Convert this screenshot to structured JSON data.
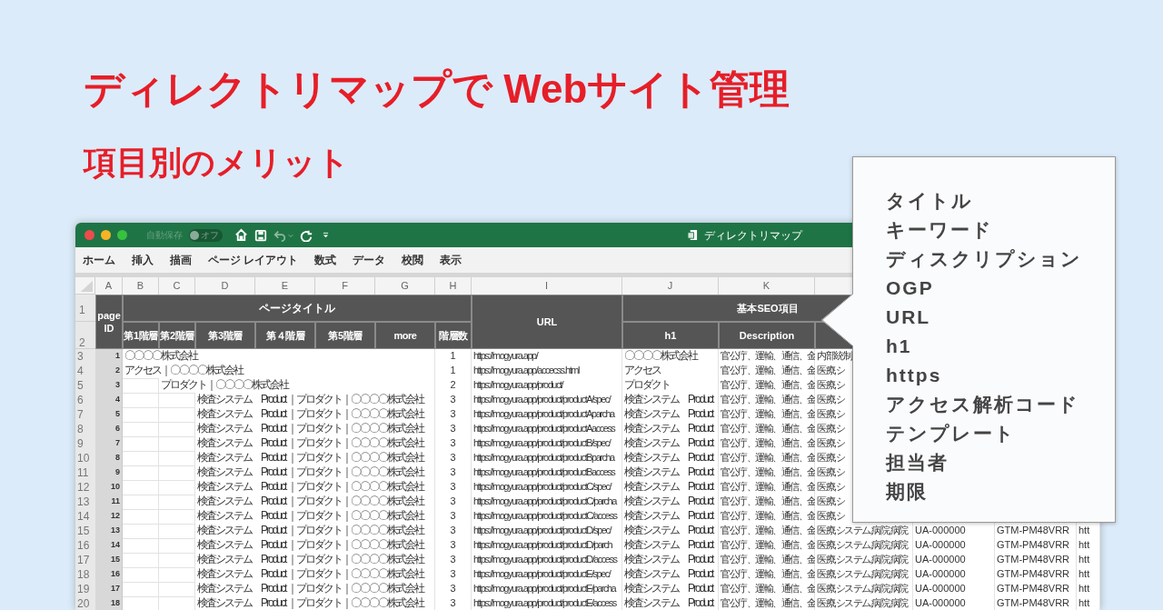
{
  "headline": "ディレクトリマップで Webサイト管理",
  "subheadline": "項目別のメリット",
  "window": {
    "title": "ディレクトリマップ",
    "autosave": {
      "label": "自動保存",
      "toggle_text": "オフ",
      "on": false
    }
  },
  "ribbon_tabs": [
    "ホーム",
    "挿入",
    "描画",
    "ページ レイアウト",
    "数式",
    "データ",
    "校閲",
    "表示"
  ],
  "sheet": {
    "column_letters": [
      "A",
      "B",
      "C",
      "D",
      "E",
      "F",
      "G",
      "H",
      "I",
      "J",
      "K"
    ],
    "header": {
      "row_numbers": [
        "1",
        "2"
      ],
      "page_id": "page ID",
      "page_title": "ページタイトル",
      "levels": [
        "第1階層",
        "第2階層",
        "第3階層",
        "第４階層",
        "第5階層",
        "more",
        "階層数"
      ],
      "url": "URL",
      "seo_group": "基本SEO項目",
      "seo_columns": [
        "h1",
        "Description"
      ]
    },
    "rows": [
      {
        "number": "3",
        "page_id": "1",
        "kind": "first",
        "title": "〇〇〇〇株式会社",
        "depth": "1",
        "url": "https://mogyura.app/",
        "h1": "〇〇〇〇株式会社",
        "description": "官公庁、運輸、通信、金",
        "column_l": "内部統制"
      },
      {
        "number": "4",
        "page_id": "2",
        "kind": "first",
        "title": "アクセス｜〇〇〇〇株式会社",
        "depth": "1",
        "url": "https://mogyura.app/accecss.html",
        "h1": "アクセス",
        "description": "官公庁、運輸、通信、金",
        "column_l": "医療,シ"
      },
      {
        "number": "5",
        "page_id": "3",
        "kind": "second",
        "title": "プロダクト｜〇〇〇〇株式会社",
        "depth": "2",
        "url": "https://mogyura.app/product/",
        "h1": "プロダクト",
        "description": "官公庁、運輸、通信、金",
        "column_l": "医療,シ"
      },
      {
        "number": "6",
        "page_id": "4",
        "kind": "third",
        "title": "検査システム　Product ｜プロダクト｜〇〇〇〇株式会社",
        "depth": "3",
        "url": "https://mogyura.app/product/productA/spec/",
        "h1": "検査システム　Product",
        "description": "官公庁、運輸、通信、金",
        "column_l": "医療,シ"
      },
      {
        "number": "7",
        "page_id": "5",
        "kind": "third",
        "title": "検査システム　Product ｜プロダクト｜〇〇〇〇株式会社",
        "depth": "3",
        "url": "https://mogyura.app/product/productAparcha",
        "h1": "検査システム　Product",
        "description": "官公庁、運輸、通信、金",
        "column_l": "医療,シ"
      },
      {
        "number": "8",
        "page_id": "6",
        "kind": "third",
        "title": "検査システム　Product ｜プロダクト｜〇〇〇〇株式会社",
        "depth": "3",
        "url": "https://mogyura.app/product/productAaccess",
        "h1": "検査システム　Product",
        "description": "官公庁、運輸、通信、金",
        "column_l": "医療,シ"
      },
      {
        "number": "9",
        "page_id": "7",
        "kind": "third",
        "title": "検査システム　Product ｜プロダクト｜〇〇〇〇株式会社",
        "depth": "3",
        "url": "https://mogyura.app/product/productB/spec/",
        "h1": "検査システム　Product",
        "description": "官公庁、運輸、通信、金",
        "column_l": "医療,シ"
      },
      {
        "number": "10",
        "page_id": "8",
        "kind": "third",
        "title": "検査システム　Product ｜プロダクト｜〇〇〇〇株式会社",
        "depth": "3",
        "url": "https://mogyura.app/product/productBparcha",
        "h1": "検査システム　Product",
        "description": "官公庁、運輸、通信、金",
        "column_l": "医療,シ"
      },
      {
        "number": "11",
        "page_id": "9",
        "kind": "third",
        "title": "検査システム　Product ｜プロダクト｜〇〇〇〇株式会社",
        "depth": "3",
        "url": "https://mogyura.app/product/productBaccess",
        "h1": "検査システム　Product",
        "description": "官公庁、運輸、通信、金",
        "column_l": "医療,シ"
      },
      {
        "number": "12",
        "page_id": "10",
        "kind": "third",
        "title": "検査システム　Product ｜プロダクト｜〇〇〇〇株式会社",
        "depth": "3",
        "url": "https://mogyura.app/product/productC/spec/",
        "h1": "検査システム　Product",
        "description": "官公庁、運輸、通信、金",
        "column_l": "医療,シ"
      },
      {
        "number": "13",
        "page_id": "11",
        "kind": "third",
        "title": "検査システム　Product ｜プロダクト｜〇〇〇〇株式会社",
        "depth": "3",
        "url": "https://mogyura.app/product/productC/parcha",
        "h1": "検査システム　Product",
        "description": "官公庁、運輸、通信、金",
        "column_l": "医療,シ"
      },
      {
        "number": "14",
        "page_id": "12",
        "kind": "third",
        "title": "検査システム　Product ｜プロダクト｜〇〇〇〇株式会社",
        "depth": "3",
        "url": "https://mogyura.app/product/productC/access",
        "h1": "検査システム　Product",
        "description": "官公庁、運輸、通信、金",
        "column_l": "医療,シ"
      },
      {
        "number": "15",
        "page_id": "13",
        "kind": "third",
        "title": "検査システム　Product ｜プロダクト｜〇〇〇〇株式会社",
        "depth": "3",
        "url": "https://mogyura.app/product/productD/spec/",
        "h1": "検査システム　Product",
        "description": "官公庁、運輸、通信、金",
        "column_l": "医療,システム,病院,病院",
        "column_m": "UA-000000",
        "column_n": "GTM-PM48VRR",
        "column_o": "htt"
      },
      {
        "number": "16",
        "page_id": "14",
        "kind": "third",
        "title": "検査システム　Product ｜プロダクト｜〇〇〇〇株式会社",
        "depth": "3",
        "url": "https://mogyura.app/product/productD/parch",
        "h1": "検査システム　Product",
        "description": "官公庁、運輸、通信、金",
        "column_l": "医療,システム,病院,病院",
        "column_m": "UA-000000",
        "column_n": "GTM-PM48VRR",
        "column_o": "htt"
      },
      {
        "number": "17",
        "page_id": "15",
        "kind": "third",
        "title": "検査システム　Product ｜プロダクト｜〇〇〇〇株式会社",
        "depth": "3",
        "url": "https://mogyura.app/product/productD/access",
        "h1": "検査システム　Product",
        "description": "官公庁、運輸、通信、金",
        "column_l": "医療,システム,病院,病院",
        "column_m": "UA-000000",
        "column_n": "GTM-PM48VRR",
        "column_o": "htt"
      },
      {
        "number": "18",
        "page_id": "16",
        "kind": "third",
        "title": "検査システム　Product ｜プロダクト｜〇〇〇〇株式会社",
        "depth": "3",
        "url": "https://mogyura.app/product/productE/spec/",
        "h1": "検査システム　Product",
        "description": "官公庁、運輸、通信、金",
        "column_l": "医療,システム,病院,病院",
        "column_m": "UA-000000",
        "column_n": "GTM-PM48VRR",
        "column_o": "htt"
      },
      {
        "number": "19",
        "page_id": "17",
        "kind": "third",
        "title": "検査システム　Product ｜プロダクト｜〇〇〇〇株式会社",
        "depth": "3",
        "url": "https://mogyura.app/product/productE/parcha",
        "h1": "検査システム　Product",
        "description": "官公庁、運輸、通信、金",
        "column_l": "医療,システム,病院,病院",
        "column_m": "UA-000000",
        "column_n": "GTM-PM48VRR",
        "column_o": "htt"
      },
      {
        "number": "20",
        "page_id": "18",
        "kind": "third",
        "title": "検査システム　Product ｜プロダクト｜〇〇〇〇株式会社",
        "depth": "3",
        "url": "https://mogyura.app/product/productE/access",
        "h1": "検査システム　Product",
        "description": "官公庁、運輸、通信、金",
        "column_l": "医療,システム,病院,病院",
        "column_m": "UA-000000",
        "column_n": "GTM-PM48VRR",
        "column_o": "htt"
      }
    ]
  },
  "callout": {
    "items": [
      "タイトル",
      "キーワード",
      "ディスクリプション",
      "OGP",
      "URL",
      "h1",
      "https",
      "アクセス解析コード",
      "テンプレート",
      "担当者",
      "期限"
    ]
  }
}
